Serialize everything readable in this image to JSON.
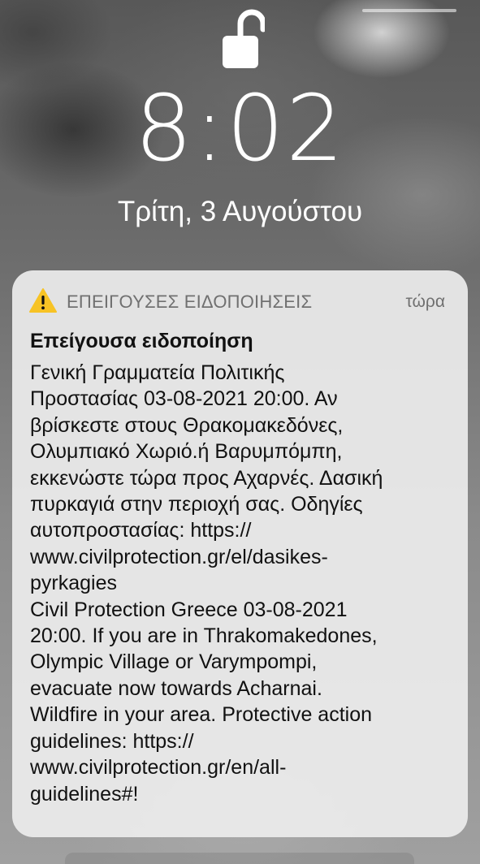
{
  "lock_screen": {
    "lock_state": "unlocked",
    "lock_icon": "unlocked-padlock-icon",
    "time": "8:02",
    "date": "Τρίτη, 3 Αυγούστου"
  },
  "notification": {
    "icon": "warning-triangle-icon",
    "app_name": "ΕΠΕΙΓΟΥΣΕΣ ΕΙΔΟΠΟΙΗΣΕΙΣ",
    "time": "τώρα",
    "title": "Επείγουσα ειδοποίηση",
    "body_lines": [
      "Γενική Γραμματεία Πολιτικής",
      "Προστασίας 03-08-2021 20:00. Αν",
      "βρίσκεστε στους Θρακομακεδόνες,",
      "Ολυμπιακό Χωριό.ή Βαρυμπόμπη,",
      "εκκενώστε τώρα προς Αχαρνές. Δασική",
      "πυρκαγιά στην περιοχή σας. Οδηγίες",
      "αυτοπροστασίας: https://",
      "www.civilprotection.gr/el/dasikes-",
      "pyrkagies",
      "Civil Protection Greece 03-08-2021",
      "20:00. If you are in Thrakomakedones,",
      "Olympic Village or Varympompi,",
      "evacuate now towards Acharnai.",
      "Wildfire in your area. Protective action",
      "guidelines: https://",
      "www.civilprotection.gr/en/all-",
      "guidelines#!"
    ]
  },
  "colors": {
    "warning_yellow": "#F7C325",
    "card_background": "#ECECEC",
    "secondary_text": "#707070",
    "primary_text": "#111111"
  }
}
